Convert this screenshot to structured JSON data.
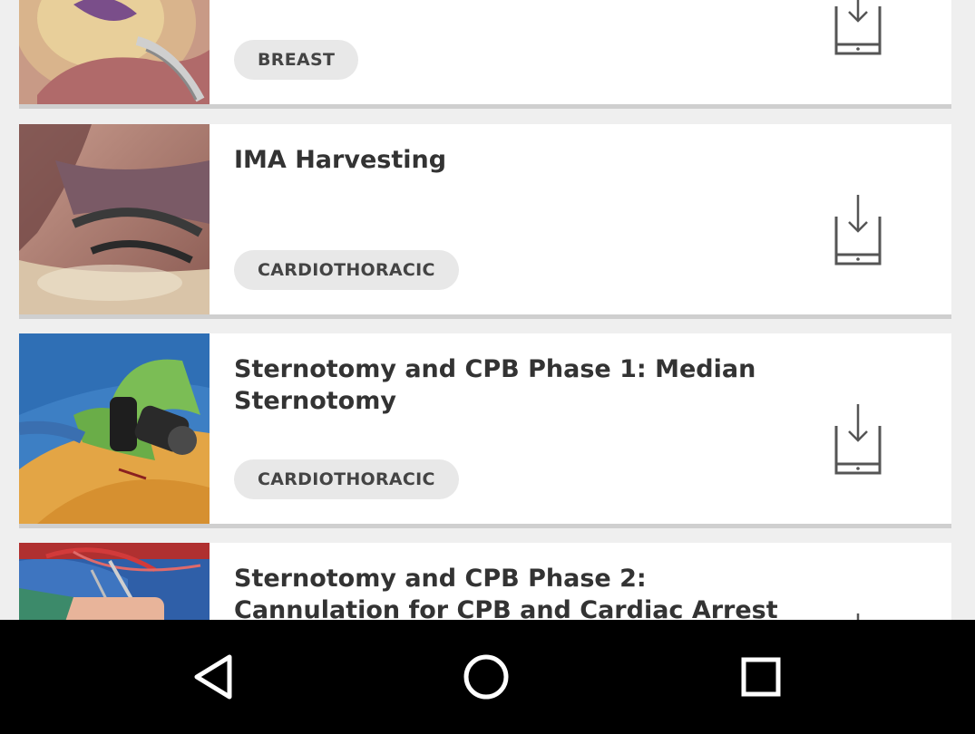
{
  "list": {
    "items": [
      {
        "title": "",
        "tag": "BREAST"
      },
      {
        "title": "IMA Harvesting",
        "tag": "CARDIOTHORACIC"
      },
      {
        "title": "Sternotomy and CPB Phase 1: Median Sternotomy",
        "tag": "CARDIOTHORACIC"
      },
      {
        "title": "Sternotomy and CPB Phase 2: Cannulation for CPB and Cardiac Arrest",
        "tag": ""
      }
    ],
    "download_icon": "download-to-device-icon"
  },
  "navbar": {
    "back_icon": "back-triangle-icon",
    "home_icon": "home-circle-icon",
    "recents_icon": "recents-square-icon"
  },
  "colors": {
    "background": "#efefef",
    "card": "#ffffff",
    "title_text": "#333333",
    "tag_bg": "#e8e8e8",
    "icon_gray": "#555555",
    "navbar": "#000000"
  }
}
